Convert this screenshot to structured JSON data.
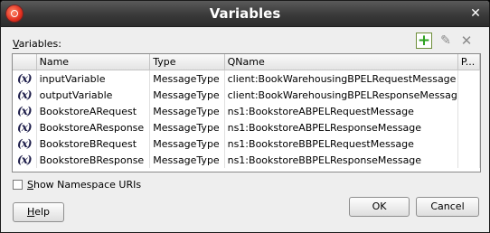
{
  "window": {
    "title": "Variables"
  },
  "variables_label": {
    "prefix": "V",
    "rest": "ariables:"
  },
  "toolbar": {
    "add_icon": "add-icon",
    "edit_icon": "pencil-icon",
    "delete_icon": "delete-x-icon"
  },
  "table": {
    "columns": [
      "Name",
      "Type",
      "QName",
      "P..."
    ],
    "rows": [
      {
        "icon": "(x)",
        "name": "inputVariable",
        "type": "MessageType",
        "qname": "client:BookWarehousingBPELRequestMessage"
      },
      {
        "icon": "(x)",
        "name": "outputVariable",
        "type": "MessageType",
        "qname": "client:BookWarehousingBPELResponseMessage"
      },
      {
        "icon": "(x)",
        "name": "BookstoreARequest",
        "type": "MessageType",
        "qname": "ns1:BookstoreABPELRequestMessage"
      },
      {
        "icon": "(x)",
        "name": "BookstoreAResponse",
        "type": "MessageType",
        "qname": "ns1:BookstoreABPELResponseMessage"
      },
      {
        "icon": "(x)",
        "name": "BookstoreBRequest",
        "type": "MessageType",
        "qname": "ns1:BookstoreBBPELRequestMessage"
      },
      {
        "icon": "(x)",
        "name": "BookstoreBResponse",
        "type": "MessageType",
        "qname": "ns1:BookstoreBBPELResponseMessage"
      }
    ]
  },
  "show_namespace": {
    "prefix": "S",
    "rest": "how Namespace URIs",
    "checked": false
  },
  "buttons": {
    "help": {
      "prefix": "H",
      "rest": "elp"
    },
    "ok": "OK",
    "cancel": "Cancel"
  }
}
